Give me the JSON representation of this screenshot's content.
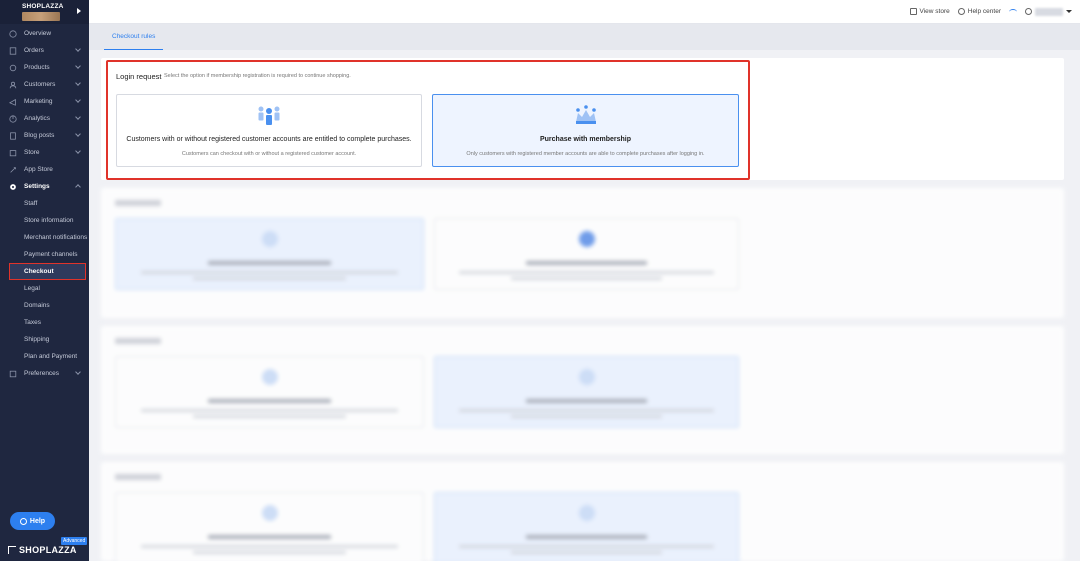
{
  "brand": {
    "name": "SHOPLAZZA"
  },
  "topbar": {
    "view_store": "View store",
    "help_center": "Help center"
  },
  "sidebar": {
    "items": [
      {
        "label": "Overview",
        "icon": "overview-icon",
        "has_children": false
      },
      {
        "label": "Orders",
        "icon": "orders-icon",
        "has_children": true
      },
      {
        "label": "Products",
        "icon": "products-icon",
        "has_children": true
      },
      {
        "label": "Customers",
        "icon": "customers-icon",
        "has_children": true
      },
      {
        "label": "Marketing",
        "icon": "marketing-icon",
        "has_children": true
      },
      {
        "label": "Analytics",
        "icon": "analytics-icon",
        "has_children": true
      },
      {
        "label": "Blog posts",
        "icon": "blog-icon",
        "has_children": true
      },
      {
        "label": "Store",
        "icon": "store-icon",
        "has_children": true
      },
      {
        "label": "App Store",
        "icon": "app-store-icon",
        "has_children": false
      },
      {
        "label": "Settings",
        "icon": "gear-icon",
        "has_children": true,
        "expanded": true
      }
    ],
    "settings_children": [
      "Staff",
      "Store information",
      "Merchant notifications",
      "Payment channels",
      "Checkout",
      "Legal",
      "Domains",
      "Taxes",
      "Shipping",
      "Plan and Payment"
    ],
    "active_child": "Checkout",
    "preferences": "Preferences",
    "help": "Help",
    "plan_badge": "Advanced",
    "footer_logo": "SHOPLAZZA"
  },
  "tabs": [
    {
      "label": "Checkout rules",
      "active": true
    }
  ],
  "login_request": {
    "title": "Login request",
    "description": "Select the option if membership registration is required to continue shopping.",
    "options": [
      {
        "title": "Customers with or without registered customer accounts are entitled to complete purchases.",
        "description": "Customers can checkout with or without a registered customer account.",
        "icon": "people-group-icon",
        "selected": false
      },
      {
        "title": "Purchase with membership",
        "description": "Only customers with registered member accounts are able to complete purchases after logging in.",
        "icon": "membership-crown-icon",
        "selected": true
      }
    ]
  },
  "colors": {
    "accent": "#2d7fef",
    "sidebar_bg": "#1f2740",
    "highlight": "#e0332a"
  }
}
